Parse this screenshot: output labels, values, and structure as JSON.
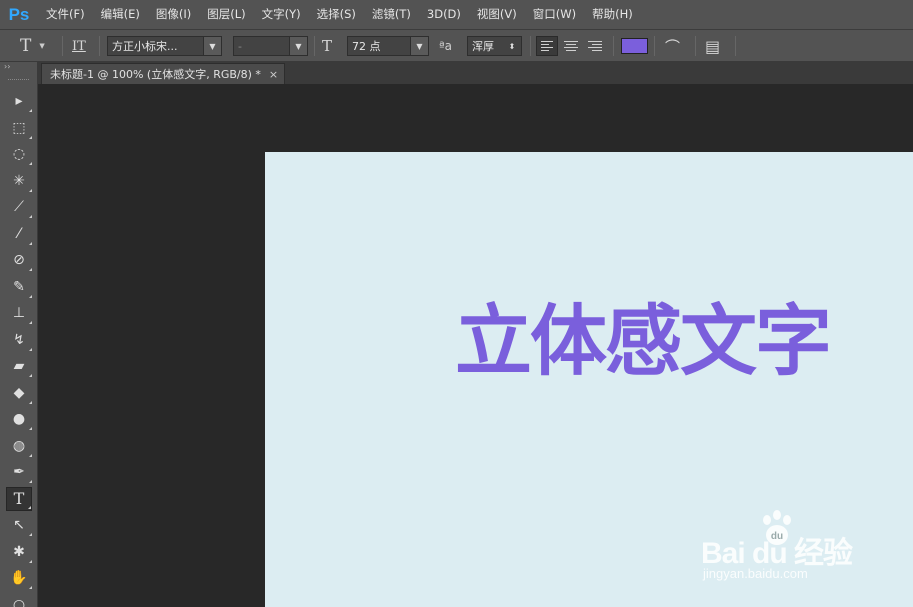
{
  "app": {
    "logo": "Ps"
  },
  "menu": [
    "文件(F)",
    "编辑(E)",
    "图像(I)",
    "图层(L)",
    "文字(Y)",
    "选择(S)",
    "滤镜(T)",
    "3D(D)",
    "视图(V)",
    "窗口(W)",
    "帮助(H)"
  ],
  "options": {
    "tool_glyph": "T",
    "orient_glyph": "IT",
    "font_family": "方正小标宋...",
    "font_style": "-",
    "font_size_glyph": "T",
    "font_size": "72 点",
    "antialias_glyph": "ªa",
    "antialias": "浑厚",
    "text_color": "#7b5fdc",
    "warp_glyph": "⌒",
    "panel_glyph": "▤"
  },
  "document": {
    "tab_title": "未标题-1 @ 100% (立体感文字, RGB/8) *",
    "close_glyph": "×"
  },
  "canvas": {
    "text": "立体感文字",
    "text_color": "#7a5fdc",
    "background": "#dcedf2"
  },
  "toolbox": {
    "collapse_glyph": "››",
    "tools": [
      {
        "name": "move-tool-icon",
        "glyph": "▸"
      },
      {
        "name": "marquee-tool-icon",
        "glyph": "⬚"
      },
      {
        "name": "lasso-tool-icon",
        "glyph": "◌"
      },
      {
        "name": "magic-wand-tool-icon",
        "glyph": "✳"
      },
      {
        "name": "crop-tool-icon",
        "glyph": "⟋"
      },
      {
        "name": "eyedropper-tool-icon",
        "glyph": "⁄"
      },
      {
        "name": "healing-brush-tool-icon",
        "glyph": "⊘"
      },
      {
        "name": "brush-tool-icon",
        "glyph": "✎"
      },
      {
        "name": "clone-stamp-tool-icon",
        "glyph": "⊥"
      },
      {
        "name": "history-brush-tool-icon",
        "glyph": "↯"
      },
      {
        "name": "eraser-tool-icon",
        "glyph": "▰"
      },
      {
        "name": "paint-bucket-tool-icon",
        "glyph": "◆"
      },
      {
        "name": "blur-tool-icon",
        "glyph": "●"
      },
      {
        "name": "dodge-tool-icon",
        "glyph": "◍"
      },
      {
        "name": "pen-tool-icon",
        "glyph": "✒"
      },
      {
        "name": "type-tool-icon",
        "glyph": "T"
      },
      {
        "name": "path-selection-tool-icon",
        "glyph": "↖"
      },
      {
        "name": "custom-shape-tool-icon",
        "glyph": "✱"
      },
      {
        "name": "hand-tool-icon",
        "glyph": "✋"
      },
      {
        "name": "zoom-tool-icon",
        "glyph": "○"
      }
    ]
  },
  "watermark": {
    "brand": "Bai  du 经验",
    "url": "jingyan.baidu.com"
  }
}
